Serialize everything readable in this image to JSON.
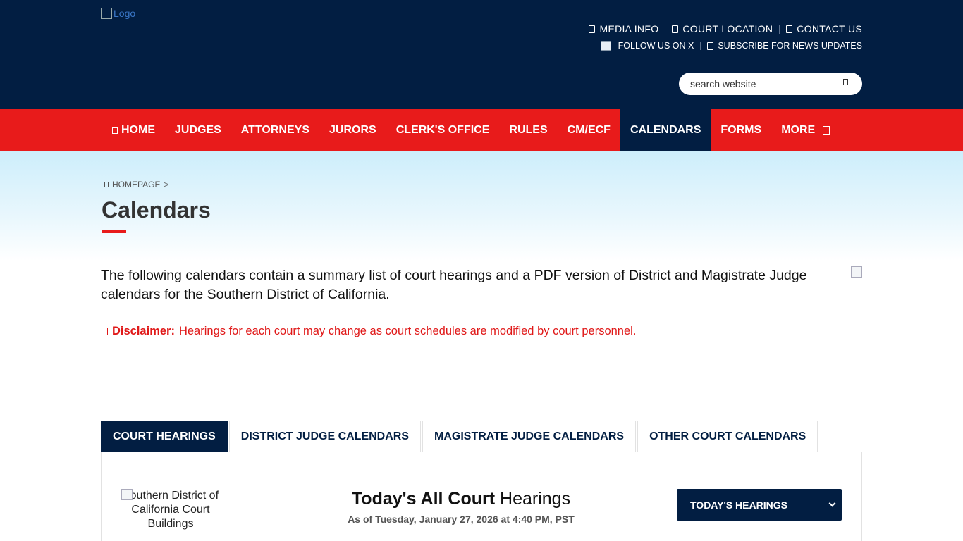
{
  "header": {
    "logo_alt": "Logo",
    "utility_links": [
      "MEDIA INFO",
      "COURT LOCATION",
      "CONTACT US"
    ],
    "social_links": [
      "FOLLOW US ON X",
      "SUBSCRIBE FOR NEWS UPDATES"
    ],
    "search_placeholder": "search website"
  },
  "nav": {
    "items": [
      "HOME",
      "JUDGES",
      "ATTORNEYS",
      "JURORS",
      "CLERK'S OFFICE",
      "RULES",
      "CM/ECF",
      "CALENDARS",
      "FORMS",
      "MORE"
    ],
    "active": "CALENDARS"
  },
  "hero": {
    "breadcrumb_home": "HOMEPAGE",
    "breadcrumb_sep": ">",
    "title": "Calendars"
  },
  "content": {
    "intro": "The following calendars contain a summary list of court hearings and a PDF version of District and Magistrate Judge calendars for the Southern District of California.",
    "disclaimer_label": "Disclaimer:",
    "disclaimer_text": "Hearings for each court may change as court schedules are modified by court personnel."
  },
  "tabs": {
    "items": [
      "COURT HEARINGS",
      "DISTRICT JUDGE CALENDARS",
      "MAGISTRATE JUDGE CALENDARS",
      "OTHER COURT CALENDARS"
    ],
    "active": "COURT HEARINGS"
  },
  "panel": {
    "building_alt": "Southern District of California Court Buildings",
    "title_bold": "Today's All Court",
    "title_rest": "Hearings",
    "as_of": "As of Tuesday, January 27, 2026 at 4:40 PM, PST",
    "select_value": "TODAY'S HEARINGS"
  },
  "colors": {
    "navy": "#021e42",
    "red": "#e81b1b"
  }
}
